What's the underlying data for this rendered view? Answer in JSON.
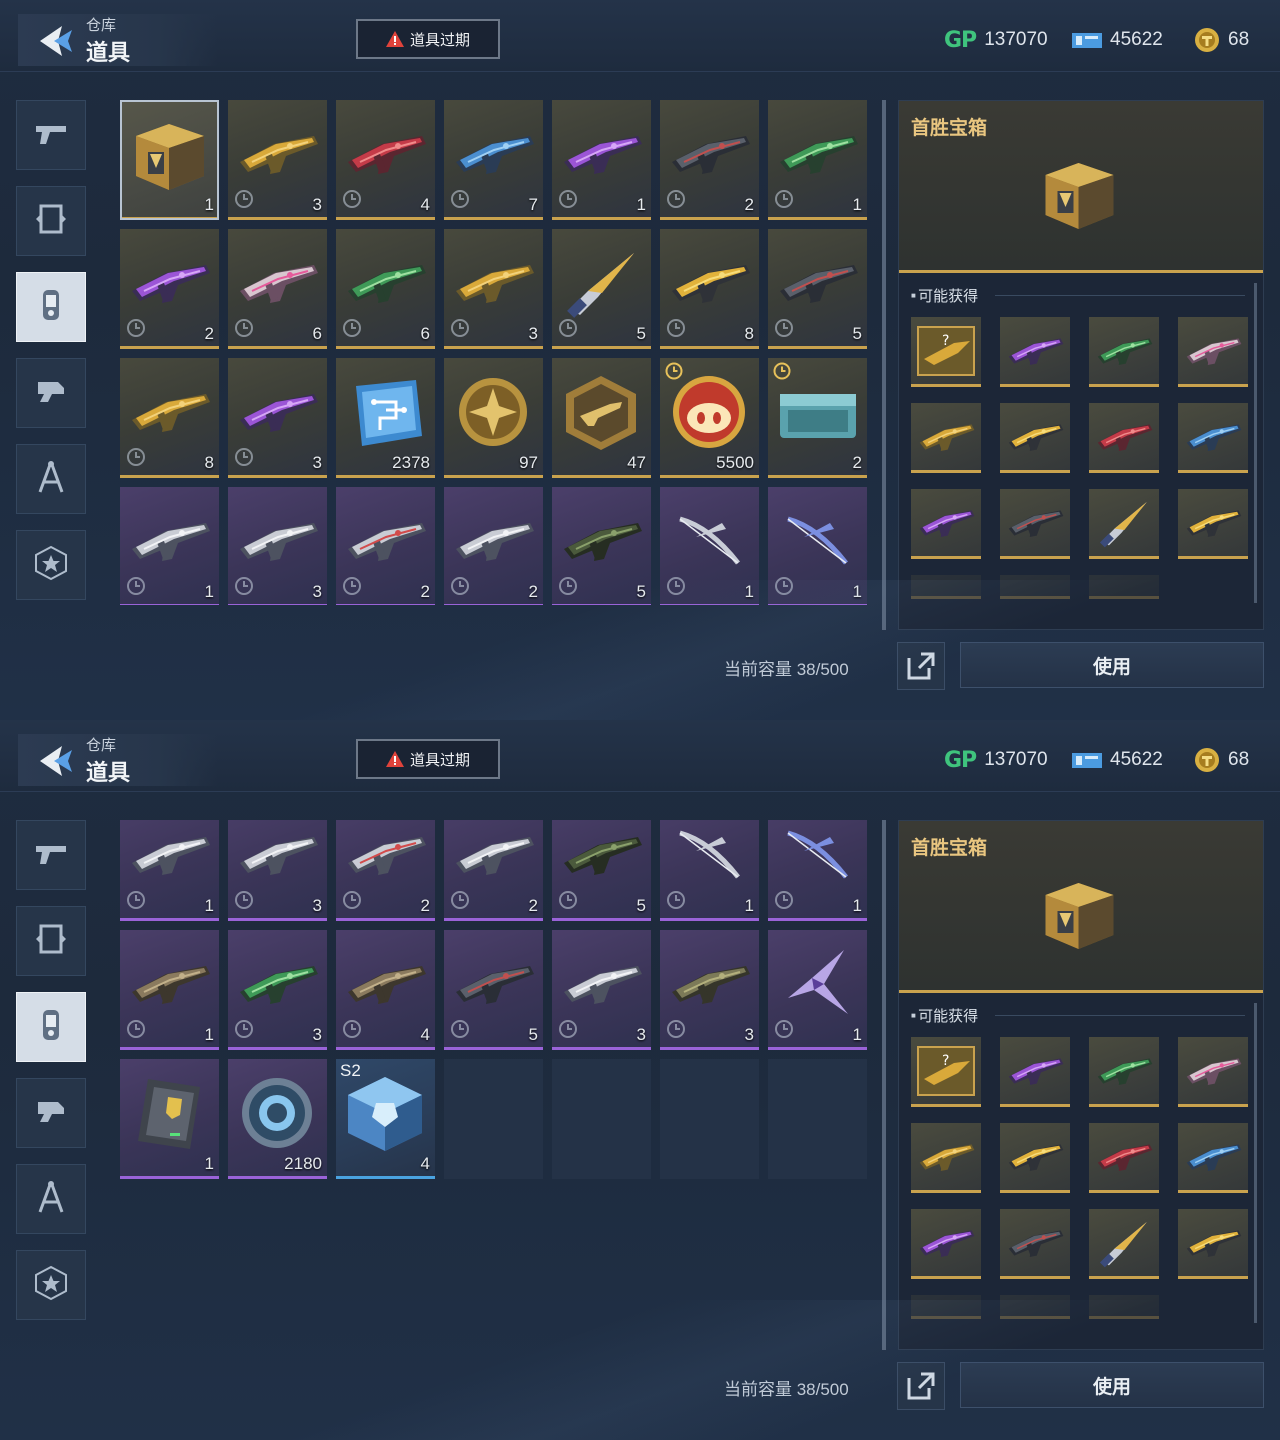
{
  "header": {
    "subtitle": "仓库",
    "title": "道具",
    "expired_button": "道具过期",
    "currency": {
      "gp_label": "GP",
      "gp": "137070",
      "tickets": "45622",
      "coins": "68"
    }
  },
  "sidebar": [
    {
      "name": "weapon-tab",
      "icon": "pistol-icon"
    },
    {
      "name": "frame-tab",
      "icon": "frame-icon"
    },
    {
      "name": "items-tab",
      "icon": "canister-icon",
      "active": true
    },
    {
      "name": "gear-tab",
      "icon": "gadget-icon"
    },
    {
      "name": "blueprint-tab",
      "icon": "compass-icon"
    },
    {
      "name": "badge-tab",
      "icon": "star-badge-icon"
    }
  ],
  "inventory": [
    {
      "art": "gold-chest",
      "qty": "1",
      "rarity": "gold",
      "selected": true
    },
    {
      "art": "gun-gold",
      "qty": "3",
      "rarity": "gold",
      "clock": true
    },
    {
      "art": "gun-red",
      "qty": "4",
      "rarity": "gold",
      "clock": true
    },
    {
      "art": "gun-blue",
      "qty": "7",
      "rarity": "gold",
      "clock": true
    },
    {
      "art": "gun-purple",
      "qty": "1",
      "rarity": "gold",
      "clock": true
    },
    {
      "art": "gun-dark",
      "qty": "2",
      "rarity": "gold",
      "clock": true
    },
    {
      "art": "gun-green",
      "qty": "1",
      "rarity": "gold",
      "clock": true
    },
    {
      "art": "gun-purple",
      "qty": "2",
      "rarity": "gold",
      "clock": true
    },
    {
      "art": "gun-pink",
      "qty": "6",
      "rarity": "gold",
      "clock": true
    },
    {
      "art": "gun-green",
      "qty": "6",
      "rarity": "gold",
      "clock": true
    },
    {
      "art": "gun-gold",
      "qty": "3",
      "rarity": "gold",
      "clock": true
    },
    {
      "art": "knife",
      "qty": "5",
      "rarity": "gold",
      "clock": true
    },
    {
      "art": "gun-yellow",
      "qty": "8",
      "rarity": "gold",
      "clock": true
    },
    {
      "art": "gun-dark",
      "qty": "5",
      "rarity": "gold",
      "clock": true
    },
    {
      "art": "gun-gold",
      "qty": "8",
      "rarity": "gold",
      "clock": true
    },
    {
      "art": "gun-purple",
      "qty": "3",
      "rarity": "gold",
      "clock": true
    },
    {
      "art": "chip",
      "qty": "2378",
      "rarity": "gold"
    },
    {
      "art": "medal-cross",
      "qty": "97",
      "rarity": "gold"
    },
    {
      "art": "hex-badge",
      "qty": "47",
      "rarity": "gold"
    },
    {
      "art": "pig-coin",
      "qty": "5500",
      "rarity": "gold",
      "timer": true
    },
    {
      "art": "teal-crate",
      "qty": "2",
      "rarity": "gold",
      "timer": true
    },
    {
      "art": "gun-silver",
      "qty": "1",
      "rarity": "purple",
      "clock": true
    },
    {
      "art": "gun-silver",
      "qty": "3",
      "rarity": "purple",
      "clock": true
    },
    {
      "art": "gun-silver-red",
      "qty": "2",
      "rarity": "purple",
      "clock": true
    },
    {
      "art": "gun-silver",
      "qty": "2",
      "rarity": "purple",
      "clock": true
    },
    {
      "art": "launcher",
      "qty": "5",
      "rarity": "purple",
      "clock": true
    },
    {
      "art": "bow",
      "qty": "1",
      "rarity": "purple",
      "clock": true
    },
    {
      "art": "bow-blue",
      "qty": "1",
      "rarity": "purple",
      "clock": true
    },
    {
      "art": "gun-brown",
      "qty": "1",
      "rarity": "purple",
      "clock": true
    },
    {
      "art": "gun-green",
      "qty": "3",
      "rarity": "purple",
      "clock": true
    },
    {
      "art": "gun-brown",
      "qty": "4",
      "rarity": "purple",
      "clock": true
    },
    {
      "art": "gun-dark",
      "qty": "5",
      "rarity": "purple",
      "clock": true
    },
    {
      "art": "gun-silver",
      "qty": "3",
      "rarity": "purple",
      "clock": true
    },
    {
      "art": "smg-olive",
      "qty": "3",
      "rarity": "purple",
      "clock": true
    },
    {
      "art": "blade-purple",
      "qty": "1",
      "rarity": "purple",
      "clock": true
    },
    {
      "art": "card",
      "qty": "1",
      "rarity": "purple"
    },
    {
      "art": "ring-disc",
      "qty": "2180",
      "rarity": "purple"
    },
    {
      "art": "crystal-box",
      "qty": "4",
      "rarity": "blue",
      "badge": "S2"
    },
    {
      "art": "",
      "qty": "",
      "rarity": "empty"
    },
    {
      "art": "",
      "qty": "",
      "rarity": "empty"
    },
    {
      "art": "",
      "qty": "",
      "rarity": "empty"
    },
    {
      "art": "",
      "qty": "",
      "rarity": "empty"
    }
  ],
  "detail": {
    "title": "首胜宝箱",
    "rewards_title": "可能获得",
    "rewards": [
      "mystery-weapon",
      "gun-purple",
      "gun-green",
      "gun-pink",
      "gun-gold",
      "gun-yellow",
      "gun-red",
      "gun-blue",
      "gun-purple",
      "gun-dark",
      "knife",
      "gun-yellow",
      "faded",
      "faded",
      "faded"
    ]
  },
  "footer": {
    "capacity": "当前容量 38/500",
    "use_button": "使用"
  },
  "colors": {
    "gold_rarity": "#c9a24e",
    "purple_rarity": "#9a63d8",
    "blue_rarity": "#4aa3e0",
    "gp_green": "#3fc47d",
    "title_gold": "#e9c680"
  }
}
